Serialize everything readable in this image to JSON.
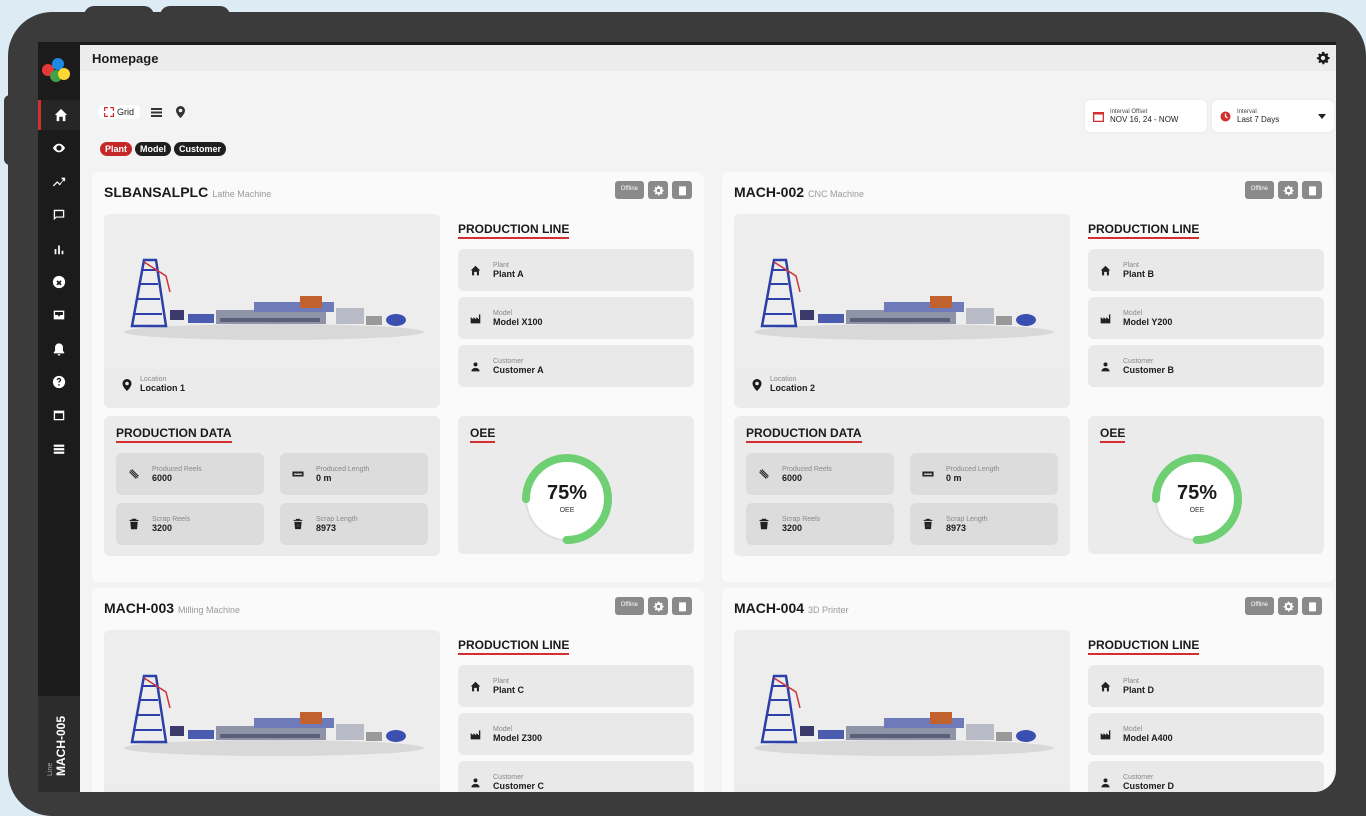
{
  "page": {
    "title": "Homepage"
  },
  "view_toggles": {
    "grid_label": "Grid"
  },
  "interval_offset": {
    "label": "Interval Offset",
    "value": "NOV 16, 24 - NOW"
  },
  "interval": {
    "label": "Interval",
    "value": "Last 7 Days"
  },
  "filters": [
    "Plant",
    "Model",
    "Customer"
  ],
  "sidebar": {
    "items": [
      "home-icon",
      "eye-icon",
      "trend-icon",
      "chat-icon",
      "bar-chart-icon",
      "x-circle-icon",
      "inbox-icon",
      "bell-icon",
      "help-icon",
      "calendar-icon",
      "list-icon"
    ],
    "bottom_label": "Line",
    "bottom_value": "MACH-005"
  },
  "labels": {
    "offline": "Offline",
    "production_line": "PRODUCTION LINE",
    "production_data": "PRODUCTION DATA",
    "oee": "OEE",
    "plant": "Plant",
    "model": "Model",
    "customer": "Customer",
    "location": "Location",
    "produced_reels": "Produced Reels",
    "produced_length": "Produced Length",
    "scrap_reels": "Scrap Reels",
    "scrap_length": "Scrap Length",
    "oee_unit": "OEE"
  },
  "machines": [
    {
      "name": "SLBANSALPLC",
      "type": "Lathe Machine",
      "plant": "Plant A",
      "model": "Model X100",
      "customer": "Customer A",
      "location": "Location 1",
      "produced_reels": "6000",
      "produced_length": "0 m",
      "scrap_reels": "3200",
      "scrap_length": "8973",
      "oee": "75%",
      "oee_fraction": 0.75
    },
    {
      "name": "MACH-002",
      "type": "CNC Machine",
      "plant": "Plant B",
      "model": "Model Y200",
      "customer": "Customer B",
      "location": "Location 2",
      "produced_reels": "6000",
      "produced_length": "0 m",
      "scrap_reels": "3200",
      "scrap_length": "8973",
      "oee": "75%",
      "oee_fraction": 0.75
    },
    {
      "name": "MACH-003",
      "type": "Milling Machine",
      "plant": "Plant C",
      "model": "Model Z300",
      "customer": "Customer C"
    },
    {
      "name": "MACH-004",
      "type": "3D Printer",
      "plant": "Plant D",
      "model": "Model A400",
      "customer": "Customer D"
    }
  ],
  "colors": {
    "accent": "#d32f2f",
    "gauge": "#6fcf73",
    "sidebar": "#1b1b1b"
  }
}
